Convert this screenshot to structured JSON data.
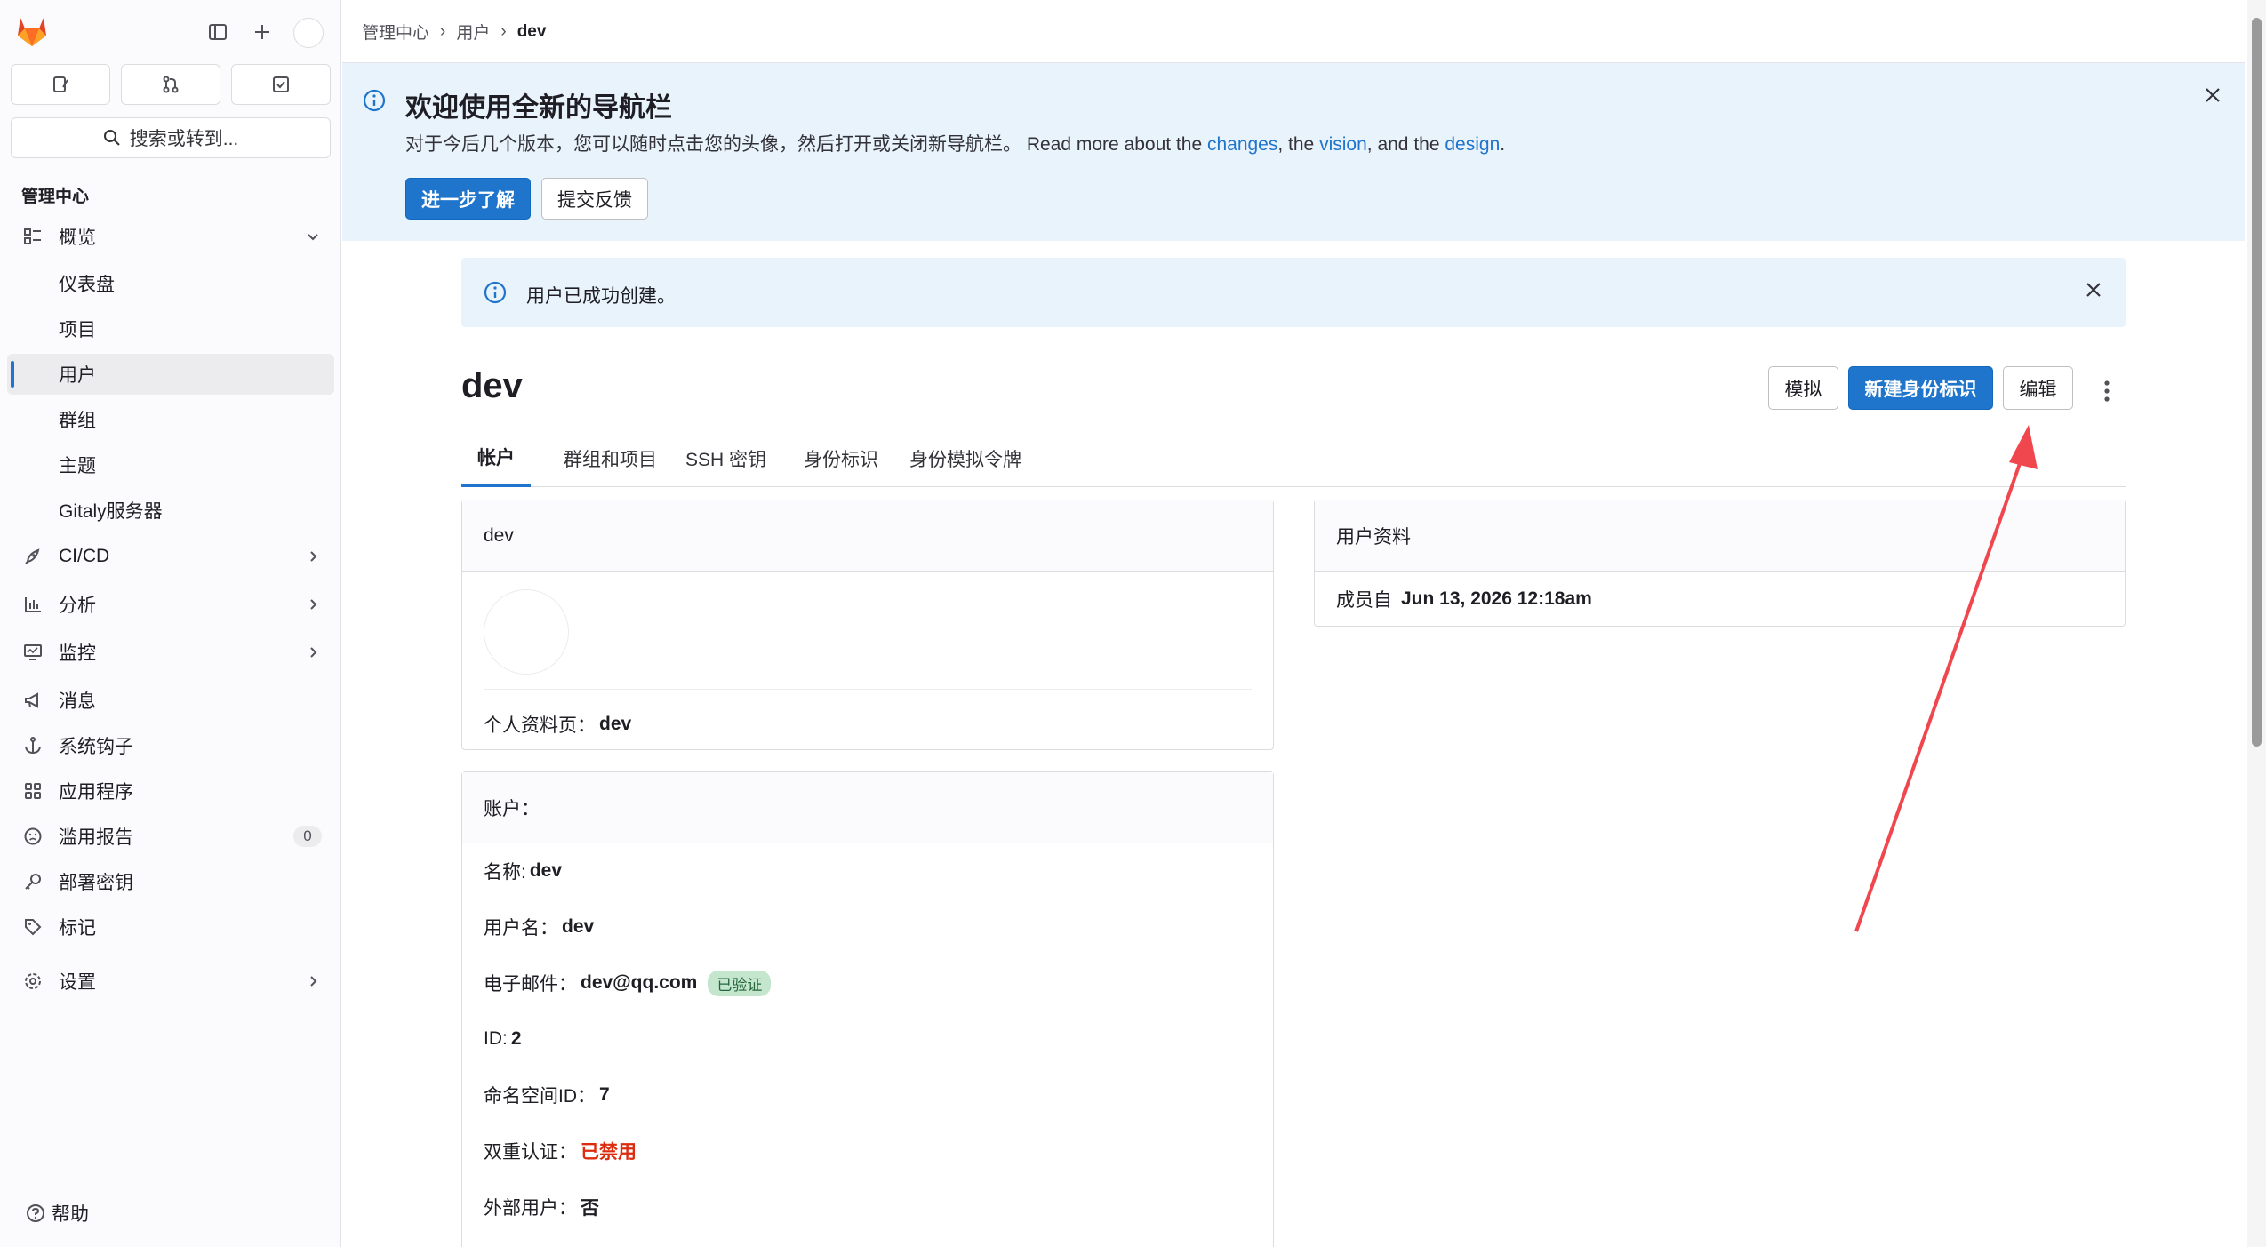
{
  "sidebar": {
    "section_title": "管理中心",
    "search_label": "搜索或转到...",
    "items": [
      {
        "label": "概览"
      },
      {
        "label": "仪表盘"
      },
      {
        "label": "项目"
      },
      {
        "label": "用户"
      },
      {
        "label": "群组"
      },
      {
        "label": "主题"
      },
      {
        "label": "Gitaly服务器"
      },
      {
        "label": "CI/CD"
      },
      {
        "label": "分析"
      },
      {
        "label": "监控"
      },
      {
        "label": "消息"
      },
      {
        "label": "系统钩子"
      },
      {
        "label": "应用程序"
      },
      {
        "label": "滥用报告",
        "count": "0"
      },
      {
        "label": "部署密钥"
      },
      {
        "label": "标记"
      },
      {
        "label": "设置"
      }
    ],
    "help_label": "帮助"
  },
  "breadcrumb": {
    "items": [
      "管理中心",
      "用户",
      "dev"
    ]
  },
  "nav_banner": {
    "title": "欢迎使用全新的导航栏",
    "body_prefix": "对于今后几个版本，您可以随时点击您的头像，然后打开或关闭新导航栏。 Read more about the ",
    "link_changes": "changes",
    "mid1": ", the ",
    "link_vision": "vision",
    "mid2": ", and the ",
    "link_design": "design",
    "suffix": ".",
    "learn_more": "进一步了解",
    "feedback": "提交反馈"
  },
  "alert": {
    "text": "用户已成功创建。"
  },
  "page": {
    "title": "dev",
    "impersonate_label": "模拟",
    "new_identity_label": "新建身份标识",
    "edit_label": "编辑"
  },
  "tabs": [
    "帐户",
    "群组和项目",
    "SSH 密钥",
    "身份标识",
    "身份模拟令牌"
  ],
  "profile_card": {
    "header": "dev",
    "profile_page_label": "个人资料页：",
    "profile_page_value": "dev"
  },
  "account_card": {
    "header": "账户：",
    "rows": [
      {
        "label": "名称:",
        "value": "dev"
      },
      {
        "label": "用户名：",
        "value": "dev"
      },
      {
        "label": "电子邮件：",
        "value": "dev@qq.com",
        "badge": "已验证"
      },
      {
        "label": "ID:",
        "value": "2"
      },
      {
        "label": "命名空间ID：",
        "value": "7"
      },
      {
        "label": "双重认证：",
        "value": "已禁用"
      },
      {
        "label": "外部用户：",
        "value": "否"
      }
    ]
  },
  "user_info_card": {
    "header": "用户资料",
    "member_since_label": "成员自",
    "member_since_value": "Jun 13, 2026 12:18am"
  },
  "colors": {
    "accent": "#1f75cb",
    "banner_bg": "#e9f3fc",
    "danger": "#dd2b0e",
    "annotation_arrow": "#f0474f"
  }
}
